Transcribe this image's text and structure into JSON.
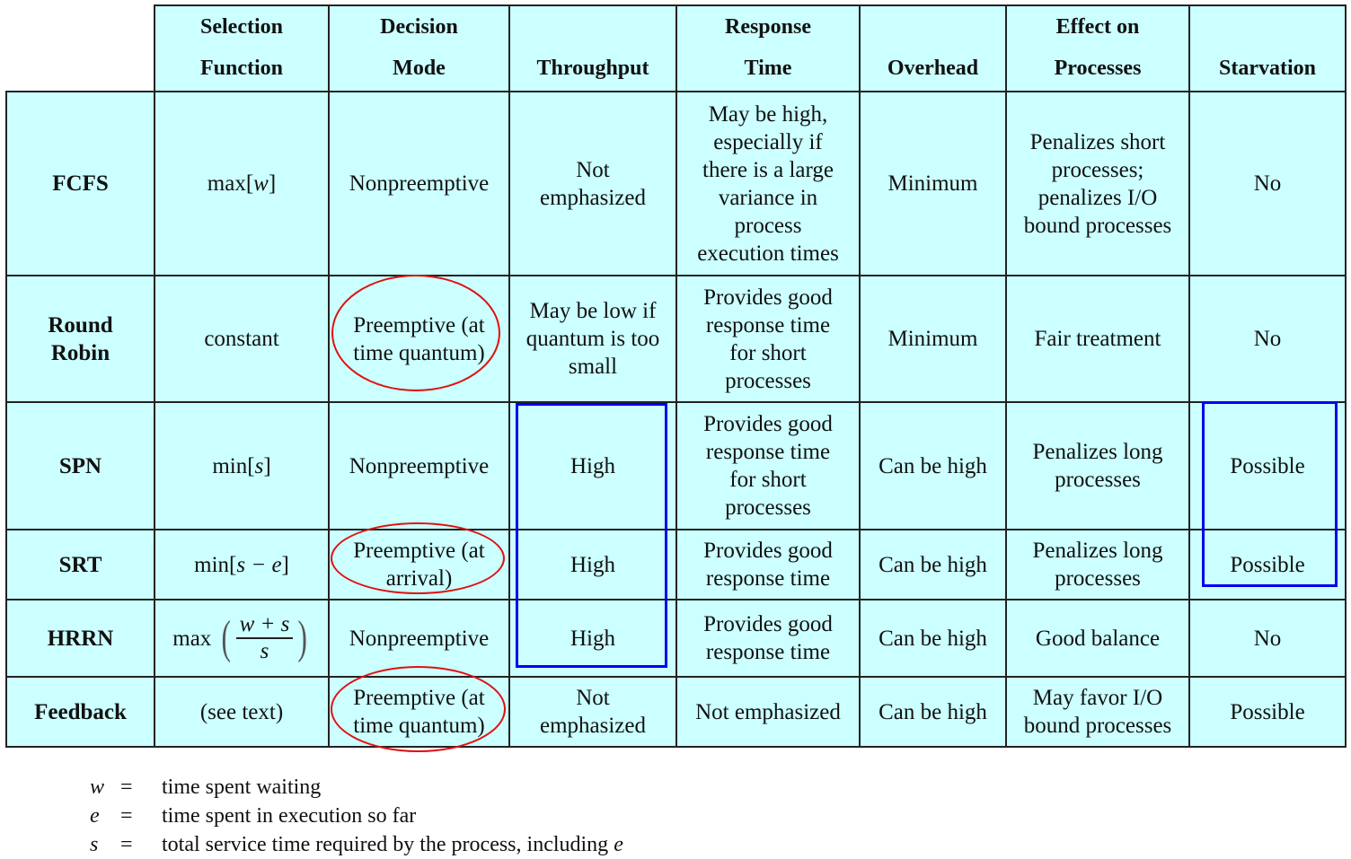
{
  "table": {
    "headers": [
      {
        "line1": "Selection",
        "line2": "Function"
      },
      {
        "line1": "Decision",
        "line2": "Mode"
      },
      {
        "line1": "",
        "line2": "Throughput"
      },
      {
        "line1": "Response",
        "line2": "Time"
      },
      {
        "line1": "",
        "line2": "Overhead"
      },
      {
        "line1": "Effect on",
        "line2": "Processes"
      },
      {
        "line1": "",
        "line2": "Starvation"
      }
    ],
    "rows": [
      {
        "policy": [
          "FCFS"
        ],
        "selection_function": {
          "prefix": "max[",
          "var": "w",
          "suffix": "]"
        },
        "decision_mode": [
          "Nonpreemptive"
        ],
        "throughput": [
          "Not",
          "emphasized"
        ],
        "response_time": [
          "May be high,",
          "especially  if",
          "there is a large",
          "variance in",
          "process",
          "execution times"
        ],
        "overhead": [
          "Minimum"
        ],
        "effect": [
          "Penalizes short",
          "processes;",
          "penalizes I/O",
          "bound processes"
        ],
        "starvation": [
          "No"
        ]
      },
      {
        "policy": [
          "Round",
          "Robin"
        ],
        "selection_function": {
          "text": "constant"
        },
        "decision_mode": [
          "Preemptive (at",
          "time quantum)"
        ],
        "throughput": [
          "May be low if",
          "quantum is too",
          "small"
        ],
        "response_time": [
          "Provides good",
          "response time",
          "for short",
          "processes"
        ],
        "overhead": [
          "Minimum"
        ],
        "effect": [
          "Fair treatment"
        ],
        "starvation": [
          "No"
        ]
      },
      {
        "policy": [
          "SPN"
        ],
        "selection_function": {
          "prefix": "min[",
          "var": "s",
          "suffix": "]"
        },
        "decision_mode": [
          "Nonpreemptive"
        ],
        "throughput": [
          "High"
        ],
        "response_time": [
          "Provides good",
          "response time",
          "for short",
          "processes"
        ],
        "overhead": [
          "Can  be high"
        ],
        "effect": [
          "Penalizes long",
          "processes"
        ],
        "starvation": [
          "Possible"
        ]
      },
      {
        "policy": [
          "SRT"
        ],
        "selection_function": {
          "prefix": "min[",
          "var": "s − e",
          "suffix": "]"
        },
        "decision_mode": [
          "Preemptive (at",
          "arrival)"
        ],
        "throughput": [
          "High"
        ],
        "response_time": [
          "Provides good",
          "response time"
        ],
        "overhead": [
          "Can  be high"
        ],
        "effect": [
          "Penalizes long",
          "processes"
        ],
        "starvation": [
          "Possible"
        ]
      },
      {
        "policy": [
          "HRRN"
        ],
        "selection_function": {
          "fraction": {
            "prefix": "max",
            "numerator": "w + s",
            "denominator": "s"
          }
        },
        "decision_mode": [
          "Nonpreemptive"
        ],
        "throughput": [
          "High"
        ],
        "response_time": [
          "Provides good",
          "response time"
        ],
        "overhead": [
          "Can  be high"
        ],
        "effect": [
          "Good balance"
        ],
        "starvation": [
          "No"
        ]
      },
      {
        "policy": [
          "Feedback"
        ],
        "selection_function": {
          "text": "(see text)"
        },
        "decision_mode": [
          "Preemptive (at",
          "time quantum)"
        ],
        "throughput": [
          "Not",
          "emphasized"
        ],
        "response_time": [
          "Not emphasized"
        ],
        "overhead": [
          "Can  be high"
        ],
        "effect": [
          "May favor I/O",
          "bound processes"
        ],
        "starvation": [
          "Possible"
        ]
      }
    ]
  },
  "legend": [
    {
      "symbol": "w",
      "equals": "=",
      "text": "time spent waiting"
    },
    {
      "symbol": "e",
      "equals": "=",
      "text": "time spent in execution so far"
    },
    {
      "symbol": "s",
      "equals": "=",
      "text": "total service time required by the process, including ",
      "italic_suffix": "e"
    }
  ],
  "annotations": {
    "ellipse_color": "#e01010",
    "box_color": "#0000ee"
  }
}
